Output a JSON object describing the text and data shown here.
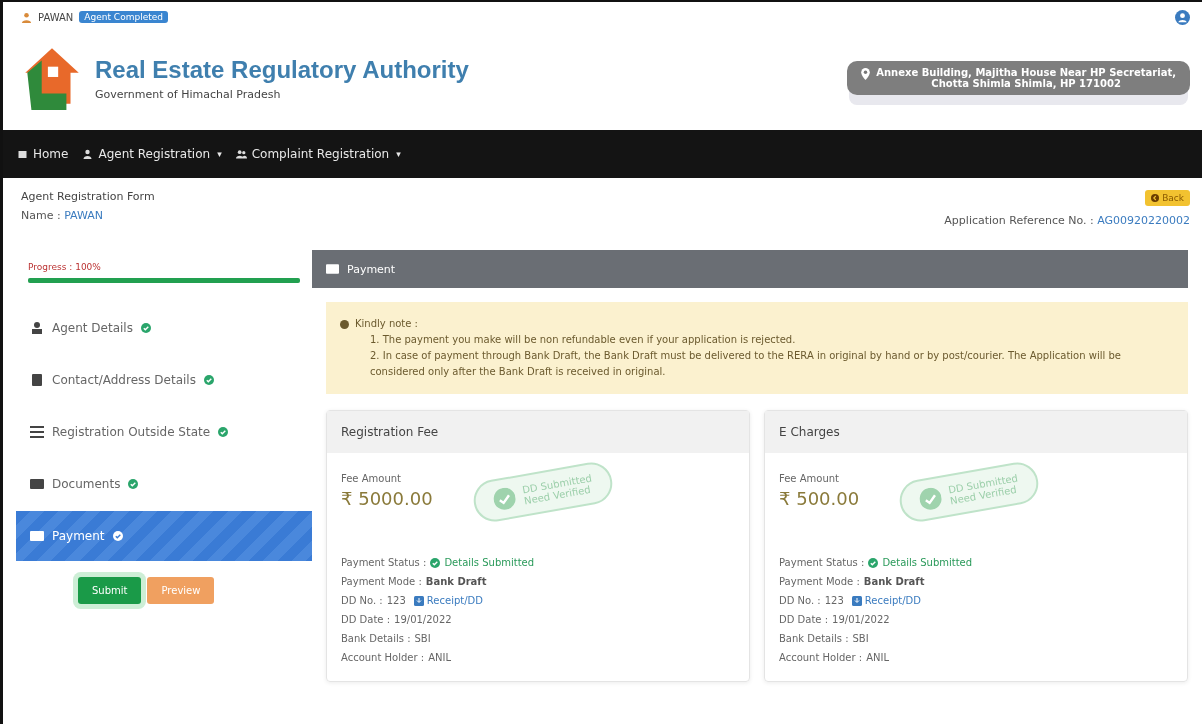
{
  "user": {
    "name": "PAWAN",
    "badge": "Agent Completed"
  },
  "brand": {
    "title": "Real Estate Regulatory Authority",
    "subtitle": "Government of Himachal Pradesh",
    "address_line_1": "Annexe Building, Majitha House Near HP Secretariat,",
    "address_line_2": "Chotta Shimla Shimla, HP 171002"
  },
  "nav": [
    {
      "label": "Home"
    },
    {
      "label": "Agent Registration",
      "caret": "▾"
    },
    {
      "label": "Complaint Registration",
      "caret": "▾"
    }
  ],
  "form": {
    "title": "Agent Registration Form",
    "name_label": "Name :",
    "name": "PAWAN",
    "back": "Back",
    "ref_label": "Application Reference No. :",
    "ref": "AG00920220002"
  },
  "progress": {
    "label": "Progress : 100%",
    "level": 1
  },
  "steps": [
    {
      "label": "Agent Details",
      "done": true,
      "selected": false
    },
    {
      "label": "Contact/Address Details",
      "done": true,
      "selected": false
    },
    {
      "label": "Registration Outside State",
      "done": true,
      "selected": false
    },
    {
      "label": "Documents",
      "done": true,
      "selected": false
    },
    {
      "label": "Payment",
      "done": true,
      "selected": true
    }
  ],
  "actions": [
    {
      "label": "Submit",
      "kind": "submit"
    },
    {
      "label": "Preview",
      "kind": "preview"
    }
  ],
  "panel": {
    "title": "Payment"
  },
  "note": {
    "heading": "Kindly note :",
    "items": [
      "1. The payment you make will be non refundable even if your application is rejected.",
      "2. In case of payment through Bank Draft, the Bank Draft must be delivered to the RERA in original by hand or by post/courier. The Application will be considered only after the Bank Draft is received in original."
    ]
  },
  "fees": [
    {
      "title": "Registration Fee",
      "amount_label": "Fee Amount",
      "amount": "₹ 5000.00",
      "stamp_line_1": "DD Submitted",
      "stamp_line_2": "Need Verified",
      "rows": [
        {
          "label": "Payment Status :",
          "value": "Details Submitted",
          "kind": "status"
        },
        {
          "label": "Payment Mode :",
          "value": "Bank Draft",
          "kind": "bold"
        },
        {
          "label": "DD No. :",
          "value": "123",
          "link": "Receipt/DD",
          "kind": "link"
        },
        {
          "label": "DD Date :",
          "value": "19/01/2022",
          "kind": "plain"
        },
        {
          "label": "Bank Details :",
          "value": "SBI",
          "kind": "plain"
        },
        {
          "label": "Account Holder :",
          "value": "ANIL",
          "kind": "plain"
        }
      ]
    },
    {
      "title": "E Charges",
      "amount_label": "Fee Amount",
      "amount": "₹ 500.00",
      "stamp_line_1": "DD Submitted",
      "stamp_line_2": "Need Verified",
      "rows": [
        {
          "label": "Payment Status :",
          "value": "Details Submitted",
          "kind": "status"
        },
        {
          "label": "Payment Mode :",
          "value": "Bank Draft",
          "kind": "bold"
        },
        {
          "label": "DD No. :",
          "value": "123",
          "link": "Receipt/DD",
          "kind": "link"
        },
        {
          "label": "DD Date :",
          "value": "19/01/2022",
          "kind": "plain"
        },
        {
          "label": "Bank Details :",
          "value": "SBI",
          "kind": "plain"
        },
        {
          "label": "Account Holder :",
          "value": "ANIL",
          "kind": "plain"
        }
      ]
    }
  ]
}
